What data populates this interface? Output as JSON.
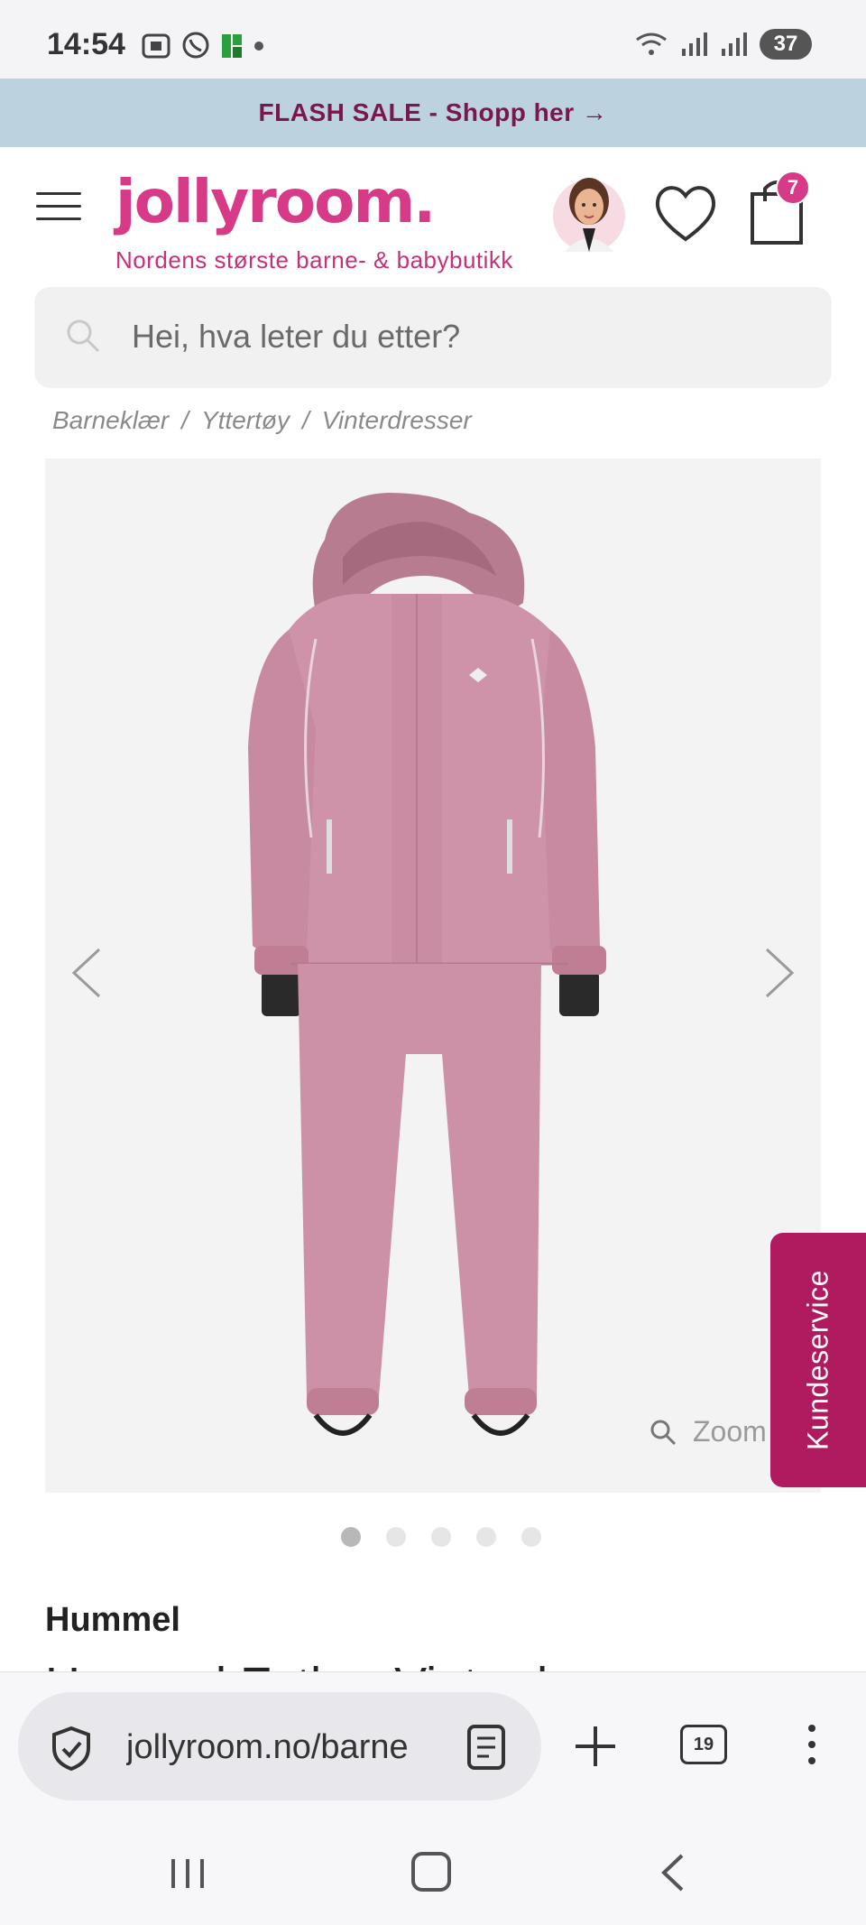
{
  "status_bar": {
    "time": "14:54",
    "battery": "37"
  },
  "flash_banner": {
    "text": "FLASH SALE - Shopp her →"
  },
  "header": {
    "logo": "jollyroom.",
    "tagline": "Nordens største barne- & babybutikk",
    "cart_count": "7"
  },
  "search": {
    "placeholder": "Hei, hva leter du etter?"
  },
  "breadcrumb": [
    {
      "label": "Barneklær"
    },
    {
      "label": "Yttertøy"
    },
    {
      "label": "Vinterdresser"
    }
  ],
  "gallery": {
    "zoom_label": "Zoom",
    "current_slide": 1,
    "slide_count": 5
  },
  "customer_service": {
    "label": "Kundeservice"
  },
  "product": {
    "brand": "Hummel",
    "title_partial": "Hummel Esther Vinterdress"
  },
  "browser": {
    "url": "jollyroom.no/barne",
    "tab_count": "19"
  },
  "colors": {
    "brand_pink": "#d73a86",
    "banner_bg": "#bcd2df",
    "banner_text": "#7a1650",
    "customer_service_bg": "#b01a5f",
    "suit_pink": "#cf93a9"
  }
}
